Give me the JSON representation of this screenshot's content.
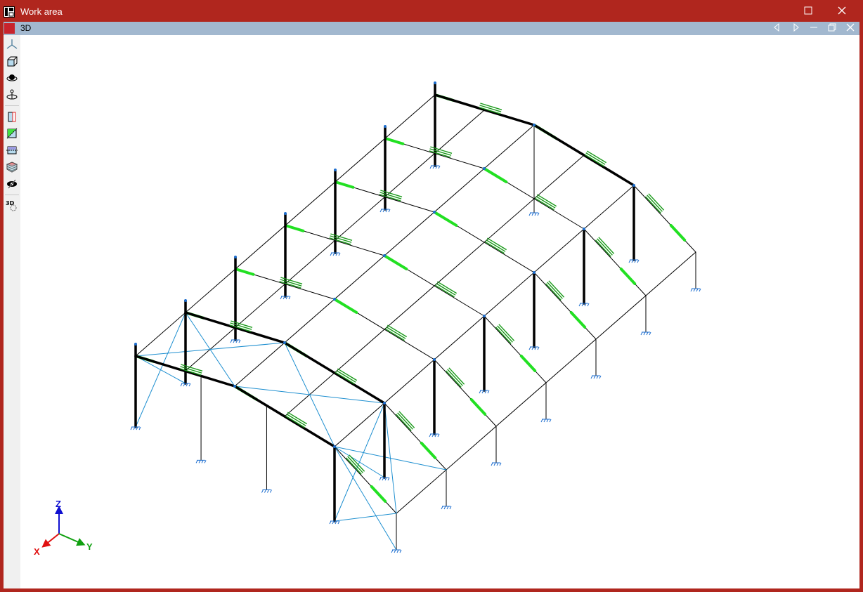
{
  "window": {
    "title": "Work area",
    "maximize_icon": "maximize-icon",
    "close_icon": "close-icon"
  },
  "view": {
    "tab_title": "3D",
    "nav": [
      "previous-icon",
      "next-icon",
      "minimize-icon",
      "restore-icon",
      "close-icon"
    ]
  },
  "toolbar": {
    "tools": [
      "axes-view-icon",
      "cube-view-icon",
      "orbit-icon",
      "rotate-icon",
      "section-plane-icon",
      "diagonal-plane-icon",
      "horizontal-plane-icon",
      "layers-icon",
      "hide-icon",
      "3d-settings-icon"
    ]
  },
  "axes": {
    "x": "X",
    "y": "Y",
    "z": "Z"
  },
  "colors": {
    "frame": "#b0261e",
    "tab_bar": "#a2b8cf",
    "member": "#000000",
    "bracing": "#1e8fd0",
    "highlight": "#22e022",
    "label": "#1a9a1a",
    "support": "#1e6fd0"
  }
}
